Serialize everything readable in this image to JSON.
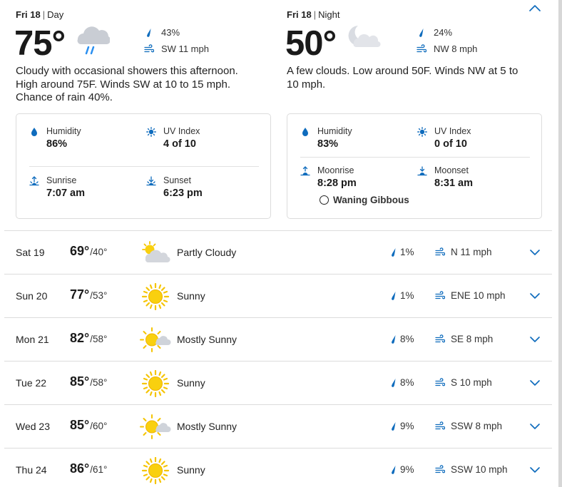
{
  "colors": {
    "accent": "#0f6cbd",
    "sun": "#f5c400",
    "cloud": "#cfd3da",
    "rain_drop": "#2a8ff0",
    "divider": "#dcdcdc"
  },
  "day": {
    "day_label": "Fri 18",
    "separator": "|",
    "period": "Day",
    "temp": "75°",
    "icon": "cloud-rain-icon",
    "precip": "43%",
    "wind": "SW 11 mph",
    "description": "Cloudy with occasional showers this afternoon. High around 75F. Winds SW at 10 to 15 mph. Chance of rain 40%.",
    "details": {
      "humidity_label": "Humidity",
      "humidity": "86%",
      "uv_label": "UV Index",
      "uv": "4 of 10",
      "sunrise_label": "Sunrise",
      "sunrise": "7:07 am",
      "sunset_label": "Sunset",
      "sunset": "6:23 pm"
    }
  },
  "night": {
    "day_label": "Fri 18",
    "separator": "|",
    "period": "Night",
    "temp": "50°",
    "icon": "moon-cloud-icon",
    "precip": "24%",
    "wind": "NW 8 mph",
    "description": "A few clouds. Low around 50F. Winds NW at 5 to 10 mph.",
    "details": {
      "humidity_label": "Humidity",
      "humidity": "83%",
      "uv_label": "UV Index",
      "uv": "0 of 10",
      "moonrise_label": "Moonrise",
      "moonrise": "8:28 pm",
      "moonset_label": "Moonset",
      "moonset": "8:31 am",
      "moon_phase": "Waning Gibbous"
    }
  },
  "forecast": [
    {
      "day": "Sat 19",
      "hi": "69°",
      "lo": "/40°",
      "icon": "partly-cloudy-icon",
      "condition": "Partly Cloudy",
      "precip": "1%",
      "wind": "N 11 mph"
    },
    {
      "day": "Sun 20",
      "hi": "77°",
      "lo": "/53°",
      "icon": "sun-icon",
      "condition": "Sunny",
      "precip": "1%",
      "wind": "ENE 10 mph"
    },
    {
      "day": "Mon 21",
      "hi": "82°",
      "lo": "/58°",
      "icon": "mostly-sunny-icon",
      "condition": "Mostly Sunny",
      "precip": "8%",
      "wind": "SE 8 mph"
    },
    {
      "day": "Tue 22",
      "hi": "85°",
      "lo": "/58°",
      "icon": "sun-icon",
      "condition": "Sunny",
      "precip": "8%",
      "wind": "S 10 mph"
    },
    {
      "day": "Wed 23",
      "hi": "85°",
      "lo": "/60°",
      "icon": "mostly-sunny-icon",
      "condition": "Mostly Sunny",
      "precip": "9%",
      "wind": "SSW 8 mph"
    },
    {
      "day": "Thu 24",
      "hi": "86°",
      "lo": "/61°",
      "icon": "sun-icon",
      "condition": "Sunny",
      "precip": "9%",
      "wind": "SSW 10 mph"
    }
  ]
}
